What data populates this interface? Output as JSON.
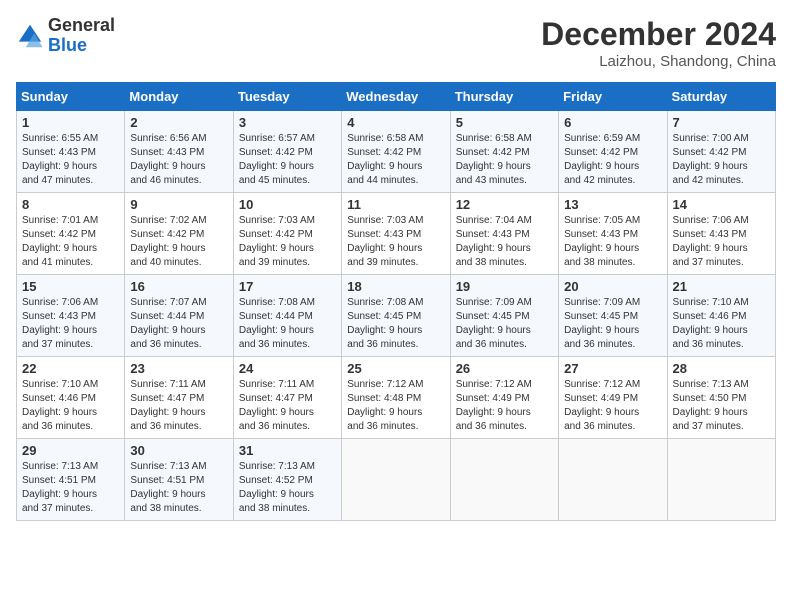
{
  "logo": {
    "line1": "General",
    "line2": "Blue"
  },
  "title": "December 2024",
  "location": "Laizhou, Shandong, China",
  "days_of_week": [
    "Sunday",
    "Monday",
    "Tuesday",
    "Wednesday",
    "Thursday",
    "Friday",
    "Saturday"
  ],
  "weeks": [
    [
      {
        "day": "1",
        "sunrise": "6:55 AM",
        "sunset": "4:43 PM",
        "daylight": "9 hours and 47 minutes."
      },
      {
        "day": "2",
        "sunrise": "6:56 AM",
        "sunset": "4:43 PM",
        "daylight": "9 hours and 46 minutes."
      },
      {
        "day": "3",
        "sunrise": "6:57 AM",
        "sunset": "4:42 PM",
        "daylight": "9 hours and 45 minutes."
      },
      {
        "day": "4",
        "sunrise": "6:58 AM",
        "sunset": "4:42 PM",
        "daylight": "9 hours and 44 minutes."
      },
      {
        "day": "5",
        "sunrise": "6:58 AM",
        "sunset": "4:42 PM",
        "daylight": "9 hours and 43 minutes."
      },
      {
        "day": "6",
        "sunrise": "6:59 AM",
        "sunset": "4:42 PM",
        "daylight": "9 hours and 42 minutes."
      },
      {
        "day": "7",
        "sunrise": "7:00 AM",
        "sunset": "4:42 PM",
        "daylight": "9 hours and 42 minutes."
      }
    ],
    [
      {
        "day": "8",
        "sunrise": "7:01 AM",
        "sunset": "4:42 PM",
        "daylight": "9 hours and 41 minutes."
      },
      {
        "day": "9",
        "sunrise": "7:02 AM",
        "sunset": "4:42 PM",
        "daylight": "9 hours and 40 minutes."
      },
      {
        "day": "10",
        "sunrise": "7:03 AM",
        "sunset": "4:42 PM",
        "daylight": "9 hours and 39 minutes."
      },
      {
        "day": "11",
        "sunrise": "7:03 AM",
        "sunset": "4:43 PM",
        "daylight": "9 hours and 39 minutes."
      },
      {
        "day": "12",
        "sunrise": "7:04 AM",
        "sunset": "4:43 PM",
        "daylight": "9 hours and 38 minutes."
      },
      {
        "day": "13",
        "sunrise": "7:05 AM",
        "sunset": "4:43 PM",
        "daylight": "9 hours and 38 minutes."
      },
      {
        "day": "14",
        "sunrise": "7:06 AM",
        "sunset": "4:43 PM",
        "daylight": "9 hours and 37 minutes."
      }
    ],
    [
      {
        "day": "15",
        "sunrise": "7:06 AM",
        "sunset": "4:43 PM",
        "daylight": "9 hours and 37 minutes."
      },
      {
        "day": "16",
        "sunrise": "7:07 AM",
        "sunset": "4:44 PM",
        "daylight": "9 hours and 36 minutes."
      },
      {
        "day": "17",
        "sunrise": "7:08 AM",
        "sunset": "4:44 PM",
        "daylight": "9 hours and 36 minutes."
      },
      {
        "day": "18",
        "sunrise": "7:08 AM",
        "sunset": "4:45 PM",
        "daylight": "9 hours and 36 minutes."
      },
      {
        "day": "19",
        "sunrise": "7:09 AM",
        "sunset": "4:45 PM",
        "daylight": "9 hours and 36 minutes."
      },
      {
        "day": "20",
        "sunrise": "7:09 AM",
        "sunset": "4:45 PM",
        "daylight": "9 hours and 36 minutes."
      },
      {
        "day": "21",
        "sunrise": "7:10 AM",
        "sunset": "4:46 PM",
        "daylight": "9 hours and 36 minutes."
      }
    ],
    [
      {
        "day": "22",
        "sunrise": "7:10 AM",
        "sunset": "4:46 PM",
        "daylight": "9 hours and 36 minutes."
      },
      {
        "day": "23",
        "sunrise": "7:11 AM",
        "sunset": "4:47 PM",
        "daylight": "9 hours and 36 minutes."
      },
      {
        "day": "24",
        "sunrise": "7:11 AM",
        "sunset": "4:47 PM",
        "daylight": "9 hours and 36 minutes."
      },
      {
        "day": "25",
        "sunrise": "7:12 AM",
        "sunset": "4:48 PM",
        "daylight": "9 hours and 36 minutes."
      },
      {
        "day": "26",
        "sunrise": "7:12 AM",
        "sunset": "4:49 PM",
        "daylight": "9 hours and 36 minutes."
      },
      {
        "day": "27",
        "sunrise": "7:12 AM",
        "sunset": "4:49 PM",
        "daylight": "9 hours and 36 minutes."
      },
      {
        "day": "28",
        "sunrise": "7:13 AM",
        "sunset": "4:50 PM",
        "daylight": "9 hours and 37 minutes."
      }
    ],
    [
      {
        "day": "29",
        "sunrise": "7:13 AM",
        "sunset": "4:51 PM",
        "daylight": "9 hours and 37 minutes."
      },
      {
        "day": "30",
        "sunrise": "7:13 AM",
        "sunset": "4:51 PM",
        "daylight": "9 hours and 38 minutes."
      },
      {
        "day": "31",
        "sunrise": "7:13 AM",
        "sunset": "4:52 PM",
        "daylight": "9 hours and 38 minutes."
      },
      null,
      null,
      null,
      null
    ]
  ]
}
